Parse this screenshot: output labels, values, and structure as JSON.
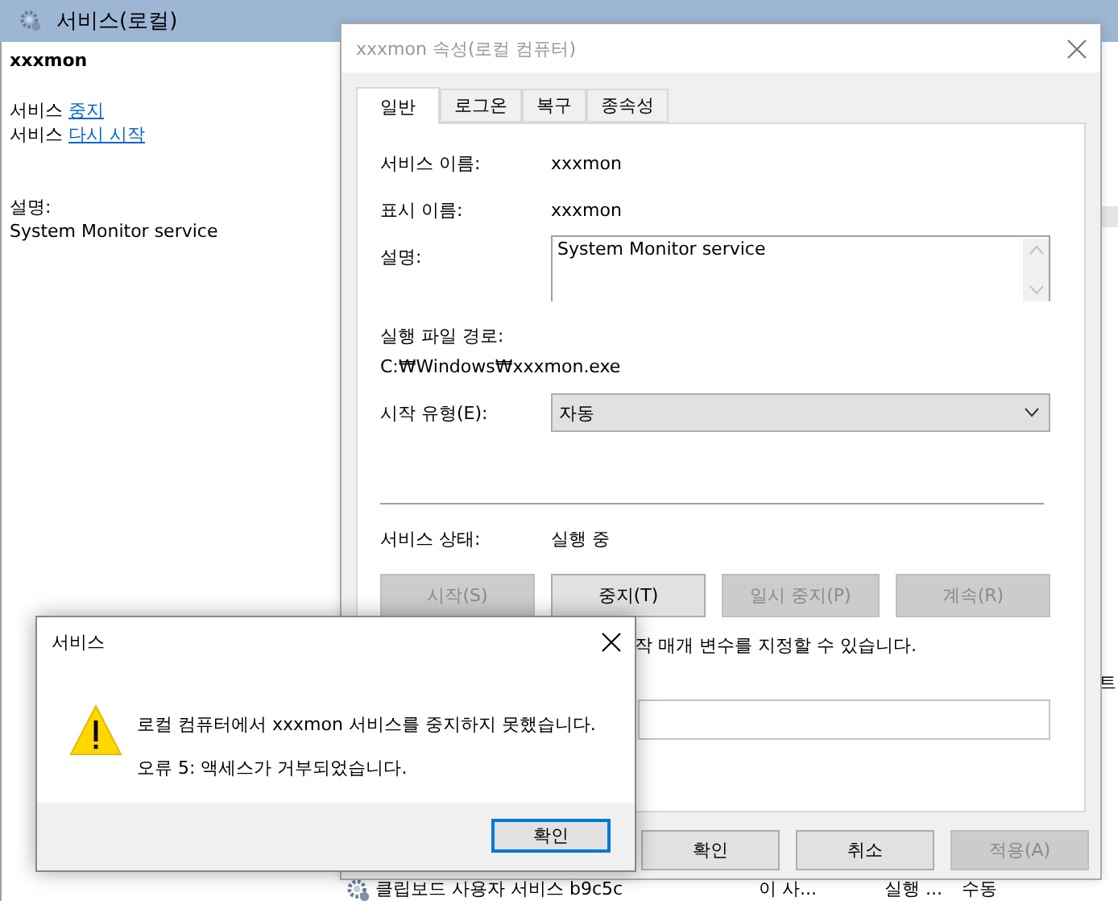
{
  "services_window": {
    "header": {
      "title": "서비스(로컬)"
    },
    "detail": {
      "service_name": "xxxmon",
      "actions": [
        {
          "prefix": "서비스",
          "link": "중지"
        },
        {
          "prefix": "서비스",
          "link": "다시 시작"
        }
      ],
      "description_label": "설명:",
      "description": "System Monitor service"
    },
    "list": {
      "fragment": "트",
      "rows": [
        {
          "column_1": "클립보드 사용자 서비스 b9c5c",
          "column_2": "이 사...",
          "column_3": "실행 ...",
          "column_4": "수동"
        }
      ]
    }
  },
  "properties_dialog": {
    "title": "xxxmon 속성(로컬 컴퓨터)",
    "tabs": [
      {
        "label": "일반",
        "selected": true
      },
      {
        "label": "로그온",
        "selected": false
      },
      {
        "label": "복구",
        "selected": false
      },
      {
        "label": "종속성",
        "selected": false
      }
    ],
    "service_name": {
      "label": "서비스 이름:",
      "value": "xxxmon"
    },
    "display_name": {
      "label": "표시 이름:",
      "value": "xxxmon"
    },
    "description": {
      "label": "설명:",
      "value": "System Monitor service"
    },
    "executable_path": {
      "label": "실행 파일 경로:",
      "value": "C:₩Windows₩xxxmon.exe"
    },
    "startup_type": {
      "label": "시작 유형(E):",
      "value": "자동"
    },
    "service_status": {
      "label": "서비스 상태:",
      "value": "실행 중"
    },
    "control_buttons": [
      {
        "label": "시작(S)",
        "disabled": true
      },
      {
        "label": "중지(T)",
        "disabled": false
      },
      {
        "label": "일시 중지(P)",
        "disabled": true
      },
      {
        "label": "계속(R)",
        "disabled": true
      }
    ],
    "start_parameters_hint": "작 매개 변수를 지정할 수 있습니다.",
    "buttons": [
      {
        "label": "확인",
        "disabled": false
      },
      {
        "label": "취소",
        "disabled": false
      },
      {
        "label": "적용(A)",
        "disabled": true
      }
    ]
  },
  "error_dialog": {
    "title": "서비스",
    "messages": [
      "로컬 컴퓨터에서 xxxmon 서비스를 중지하지 못했습니다.",
      "오류 5: 액세스가 거부되었습니다."
    ],
    "button": "확인"
  }
}
